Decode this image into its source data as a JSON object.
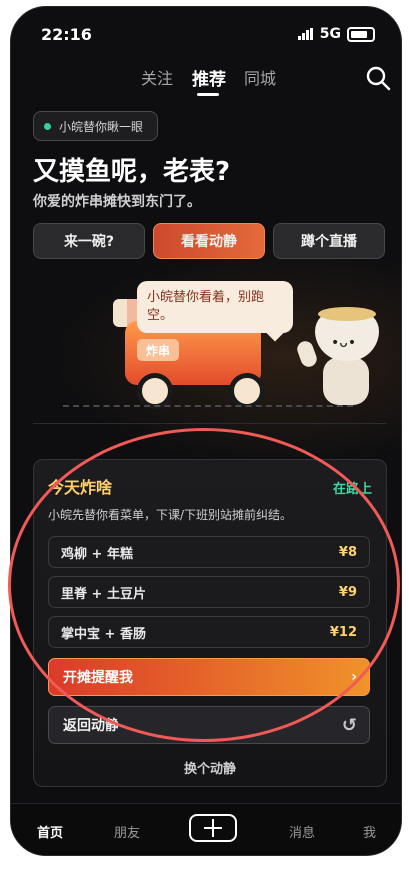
{
  "status": {
    "time": "22:16",
    "network": "5G"
  },
  "top_tabs": [
    {
      "label": "关注"
    },
    {
      "label": "推荐"
    },
    {
      "label": "同城"
    }
  ],
  "hero": {
    "pill": "小皖替你瞅一眼",
    "title": "又摸鱼呢，老表?",
    "subtitle": "你爱的炸串摊快到东门了。",
    "buttons": [
      {
        "label": "来一碗?"
      },
      {
        "label": "看看动静"
      },
      {
        "label": "蹲个直播"
      }
    ],
    "speech": "小皖替你看着，别跑空。",
    "truck_sign": "炸串"
  },
  "card": {
    "title": "今天炸啥",
    "status": "在路上",
    "desc": "小皖先替你看菜单，下课/下班别站摊前纠结。",
    "items": [
      {
        "name": "鸡柳 + 年糕",
        "price": "¥8"
      },
      {
        "name": "里脊 + 土豆片",
        "price": "¥9"
      },
      {
        "name": "掌中宝 + 香肠",
        "price": "¥12"
      }
    ],
    "remind_label": "开摊提醒我",
    "remind_arrow": "›",
    "back_label": "返回动静",
    "back_icon": "↺",
    "swap_label": "换个动静"
  },
  "bottom_nav": [
    {
      "label": "首页"
    },
    {
      "label": "朋友"
    },
    {
      "label": "消息"
    },
    {
      "label": "我"
    }
  ],
  "colors": {
    "accent": "#e4693a",
    "highlight": "#ffcf6b",
    "live": "#3fd6a0",
    "annotation": "#f05a57"
  }
}
